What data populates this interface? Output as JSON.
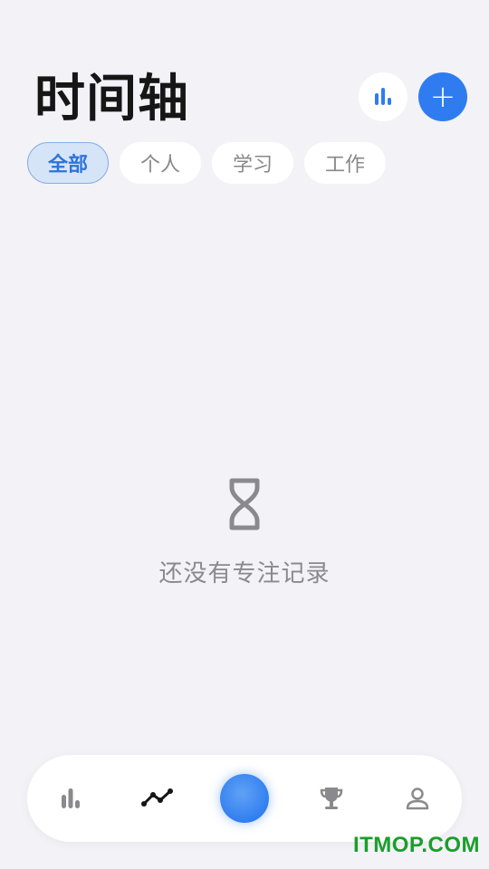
{
  "header": {
    "title": "时间轴",
    "stats_button_icon": "bar-chart-icon",
    "add_button_icon": "plus-icon",
    "add_symbol": "+"
  },
  "tabs": [
    {
      "label": "全部",
      "active": true
    },
    {
      "label": "个人",
      "active": false
    },
    {
      "label": "学习",
      "active": false
    },
    {
      "label": "工作",
      "active": false
    }
  ],
  "empty_state": {
    "icon": "hourglass-icon",
    "text": "还没有专注记录"
  },
  "bottom_nav": {
    "items": [
      {
        "icon": "bar-chart-icon",
        "active": false
      },
      {
        "icon": "timeline-icon",
        "active": true
      },
      {
        "icon": "focus-button",
        "active": false
      },
      {
        "icon": "trophy-icon",
        "active": false
      },
      {
        "icon": "profile-icon",
        "active": false
      }
    ]
  },
  "watermark": "ITMOP.COM",
  "colors": {
    "accent": "#2f7cf0",
    "background": "#f3f2f7",
    "tab_active_bg": "#d6e4f8",
    "tab_active_text": "#2d73dc",
    "muted_text": "#8a8a8e",
    "watermark": "#1a9e2c"
  }
}
